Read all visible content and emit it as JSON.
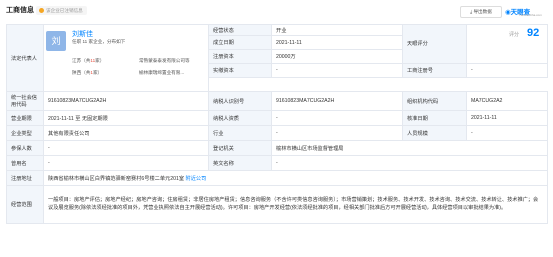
{
  "header": {
    "title": "工商信息",
    "badge": "该企业已注销信息",
    "export_label": "导出数据",
    "logo": "天眼查",
    "logo_sub": "TianYanCha.com"
  },
  "rep": {
    "label": "法定代表人",
    "avatar": "刘",
    "name": "刘斯佳",
    "sub": "任职 11 家企业，分布如下",
    "row1_prefix": "江苏（共",
    "row1_count": "11",
    "row1_suffix": "家）",
    "row1_company": "常熟蒙泰泰发有限公司等",
    "row2_prefix": "陕西（共",
    "row2_count": "1",
    "row2_suffix": "家）",
    "row2_company": "榆林康瑞缔置业有限..."
  },
  "fields": {
    "status_label": "经营状态",
    "status": "开业",
    "founded_label": "成立日期",
    "founded": "2021-11-11",
    "score_label": "天眼评分",
    "score_text": "评分",
    "score": "92",
    "reg_capital_label": "注册资本",
    "reg_capital": "20000万",
    "paid_capital_label": "实缴资本",
    "paid_capital": "-",
    "reg_no_label": "工商注册号",
    "reg_no": "-",
    "credit_code_label": "统一社会信用代码",
    "credit_code": "91610823MA7CUG2A2H",
    "tax_id_label": "纳税人识别号",
    "tax_id": "91610823MA7CUG2A2H",
    "org_code_label": "组织机构代码",
    "org_code": "MA7CUG2A2",
    "term_label": "营业期限",
    "term": "2021-11-11 至 无固定期限",
    "taxpayer_label": "纳税人资质",
    "taxpayer": "-",
    "approve_label": "核准日期",
    "approve": "2021-11-11",
    "type_label": "企业类型",
    "type": "其他有限责任公司",
    "industry_label": "行业",
    "industry": "-",
    "staff_label": "人员规模",
    "staff": "-",
    "insured_label": "参保人数",
    "insured": "-",
    "authority_label": "登记机关",
    "authority": "榆林市横山区市场监督管理局",
    "old_name_label": "曾用名",
    "old_name": "-",
    "en_name_label": "英文名称",
    "en_name": "-",
    "address_label": "注册地址",
    "address": "陕西省榆林市横山区白界镇范驿新窑赛村6号楼二单元201室",
    "address_link": "附近公司",
    "scope_label": "经营范围",
    "scope": "一般项目：房地产评估；房地产经纪；房地产咨询；住房租赁；非居住房地产租赁；信息咨询服务（不含许可类信息咨询服务）；市场营销策划；技术服务、技术开发、技术咨询、技术交流、技术转让、技术推广；会议及展览服务(除依法须经批准的项目外，凭营业执照依法自主开展经营活动)。许可项目：房地产开发经营(依法须经批准的项目，经相关部门批准后方可开展经营活动，具体经营项目以审批结果为准)。"
  }
}
